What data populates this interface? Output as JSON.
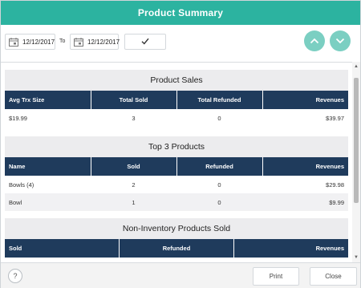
{
  "window": {
    "title": "Product Summary"
  },
  "toolbar": {
    "start_date": "12/12/2017",
    "to_label": "To",
    "end_date": "12/12/2017",
    "apply_icon": "checkmark-icon",
    "up_icon": "chevron-up-icon",
    "down_icon": "chevron-down-icon",
    "accent_color": "#2cb3a0"
  },
  "product_sales": {
    "title": "Product Sales",
    "columns": [
      "Avg Trx Size",
      "Total Sold",
      "Total Refunded",
      "Revenues"
    ],
    "rows": [
      [
        "$19.99",
        "3",
        "0",
        "$39.97"
      ]
    ]
  },
  "top_products": {
    "title": "Top 3 Products",
    "columns": [
      "Name",
      "Sold",
      "Refunded",
      "Revenues"
    ],
    "rows": [
      [
        "Bowls (4)",
        "2",
        "0",
        "$29.98"
      ],
      [
        "Bowl",
        "1",
        "0",
        "$9.99"
      ]
    ]
  },
  "non_inventory": {
    "title": "Non-Inventory Products Sold",
    "columns": [
      "Sold",
      "Refunded",
      "Revenues"
    ]
  },
  "footer": {
    "help_label": "?",
    "print_label": "Print",
    "close_label": "Close"
  },
  "colors": {
    "header_bg": "#1f3b5c",
    "title_bar": "#2cb3a0",
    "nav_button": "#7bcfc2"
  }
}
